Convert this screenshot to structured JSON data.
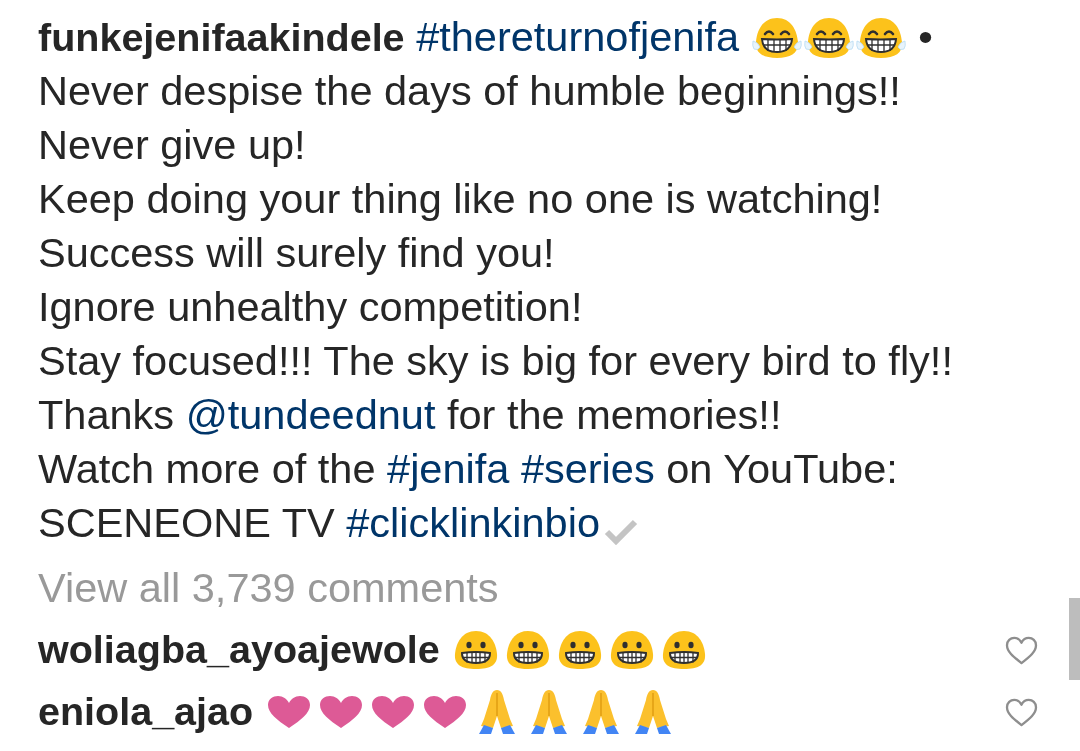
{
  "caption": {
    "lines": [
      [
        {
          "kind": "user",
          "text": "funkejenifaakindele"
        },
        {
          "kind": "hashtag",
          "text": "#thereturnofjenifa"
        },
        {
          "kind": "joy"
        },
        {
          "kind": "joy"
        },
        {
          "kind": "joy"
        },
        {
          "kind": "text",
          "text": "•"
        }
      ],
      [
        {
          "kind": "text",
          "text": "Never despise the days of humble beginnings!!"
        }
      ],
      [
        {
          "kind": "text",
          "text": "Never give up!"
        }
      ],
      [
        {
          "kind": "text",
          "text": "Keep doing your thing like no one is watching!"
        }
      ],
      [
        {
          "kind": "text",
          "text": "Success will surely find you!"
        }
      ],
      [
        {
          "kind": "text",
          "text": "Ignore unhealthy competition!"
        }
      ],
      [
        {
          "kind": "text",
          "text": "Stay focused!!! The sky is big for every bird to fly!!"
        }
      ],
      [
        {
          "kind": "text",
          "text": "Thanks"
        },
        {
          "kind": "mention",
          "text": "@tundeednut"
        },
        {
          "kind": "text",
          "text": "for the memories!!"
        }
      ],
      [
        {
          "kind": "text",
          "text": "Watch more of the"
        },
        {
          "kind": "hashtag",
          "text": "#jenifa"
        },
        {
          "kind": "hashtag",
          "text": "#series"
        },
        {
          "kind": "text",
          "text": "on YouTube:"
        }
      ],
      [
        {
          "kind": "text",
          "text": "SCENEONE TV"
        },
        {
          "kind": "hashtag",
          "text": "#clicklinkinbio"
        },
        {
          "kind": "check"
        }
      ]
    ]
  },
  "view_all": "View all 3,739 comments",
  "comments": [
    {
      "username": "woliagba_ayoajewole",
      "body": [
        {
          "kind": "grin"
        },
        {
          "kind": "grin"
        },
        {
          "kind": "grin"
        },
        {
          "kind": "grin"
        },
        {
          "kind": "grin"
        }
      ],
      "liked": false
    },
    {
      "username": "eniola_ajao",
      "body": [
        {
          "kind": "heart"
        },
        {
          "kind": "heart"
        },
        {
          "kind": "heart"
        },
        {
          "kind": "heart"
        },
        {
          "kind": "pray"
        },
        {
          "kind": "pray"
        },
        {
          "kind": "pray"
        },
        {
          "kind": "pray"
        }
      ],
      "liked": false
    }
  ]
}
